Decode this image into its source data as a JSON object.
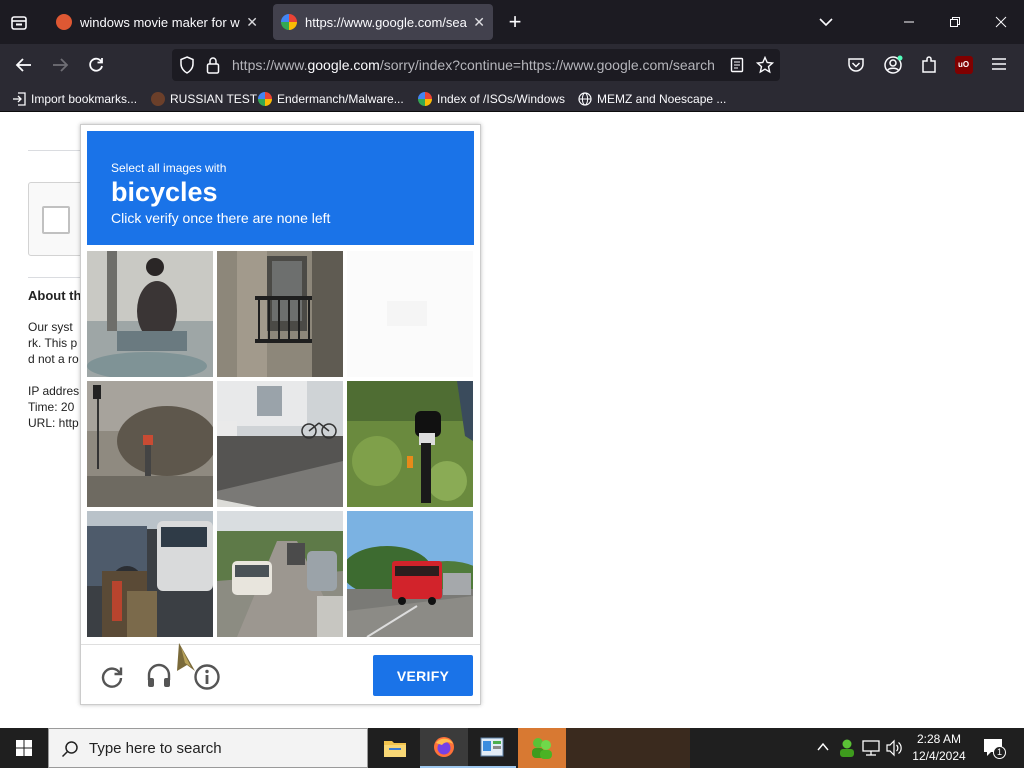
{
  "tabs": [
    {
      "title": "windows movie maker for wind",
      "active": false
    },
    {
      "title": "https://www.google.com/searc",
      "active": true
    }
  ],
  "url": {
    "prefix": "https://www.",
    "domain": "google.com",
    "rest": "/sorry/index?continue=https://www.google.com/search"
  },
  "bookmarks": [
    {
      "label": "Import bookmarks...",
      "icon": "import-icon"
    },
    {
      "label": "RUSSIAN TEST",
      "icon": "hat-icon"
    },
    {
      "label": "Endermanch/Malware...",
      "icon": "google-icon"
    },
    {
      "label": "Index of /ISOs/Windows",
      "icon": "google-icon"
    },
    {
      "label": "MEMZ and Noescape ...",
      "icon": "globe-icon"
    }
  ],
  "page": {
    "heading_fragment": "About th",
    "line1": "Our syst",
    "line2": "rk. This p",
    "line3": "d not a ro",
    "line4": "IP addres",
    "line5": "Time: 20",
    "line6": "URL: http"
  },
  "captcha": {
    "instruction": "Select all images with",
    "target": "bicycles",
    "subtext": "Click verify once there are none left",
    "verify_label": "VERIFY"
  },
  "taskbar": {
    "search_placeholder": "Type here to search",
    "time": "2:28 AM",
    "date": "12/4/2024",
    "notification_count": "1"
  },
  "colors": {
    "captcha_blue": "#1a73e8",
    "tab_bg": "#1c1b22",
    "toolbar_bg": "#2b2a33"
  }
}
